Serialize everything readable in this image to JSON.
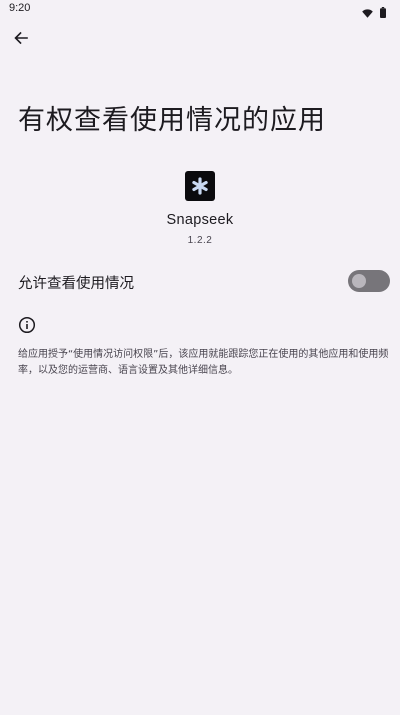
{
  "status_bar": {
    "time": "9:20",
    "icons": [
      "wifi-icon",
      "battery-icon"
    ]
  },
  "header": {
    "back_icon": "arrow-left-icon"
  },
  "page": {
    "title": "有权查看使用情况的应用"
  },
  "app": {
    "name": "Snapseek",
    "version": "1.2.2",
    "icon": "snapseek-app-icon"
  },
  "permission_toggle": {
    "label": "允许查看使用情况",
    "enabled": false
  },
  "info": {
    "icon": "info-icon",
    "description": "给应用授予“使用情况访问权限”后，该应用就能跟踪您正在使用的其他应用和使用频率，以及您的运营商、语言设置及其他详细信息。"
  },
  "colors": {
    "background": "#f4f1f6",
    "text_primary": "#1d1b20",
    "text_secondary": "#49454f",
    "switch_track_off": "#77757a",
    "switch_thumb_off": "#b9b6bc",
    "app_icon_bg": "#0b0b0e"
  }
}
